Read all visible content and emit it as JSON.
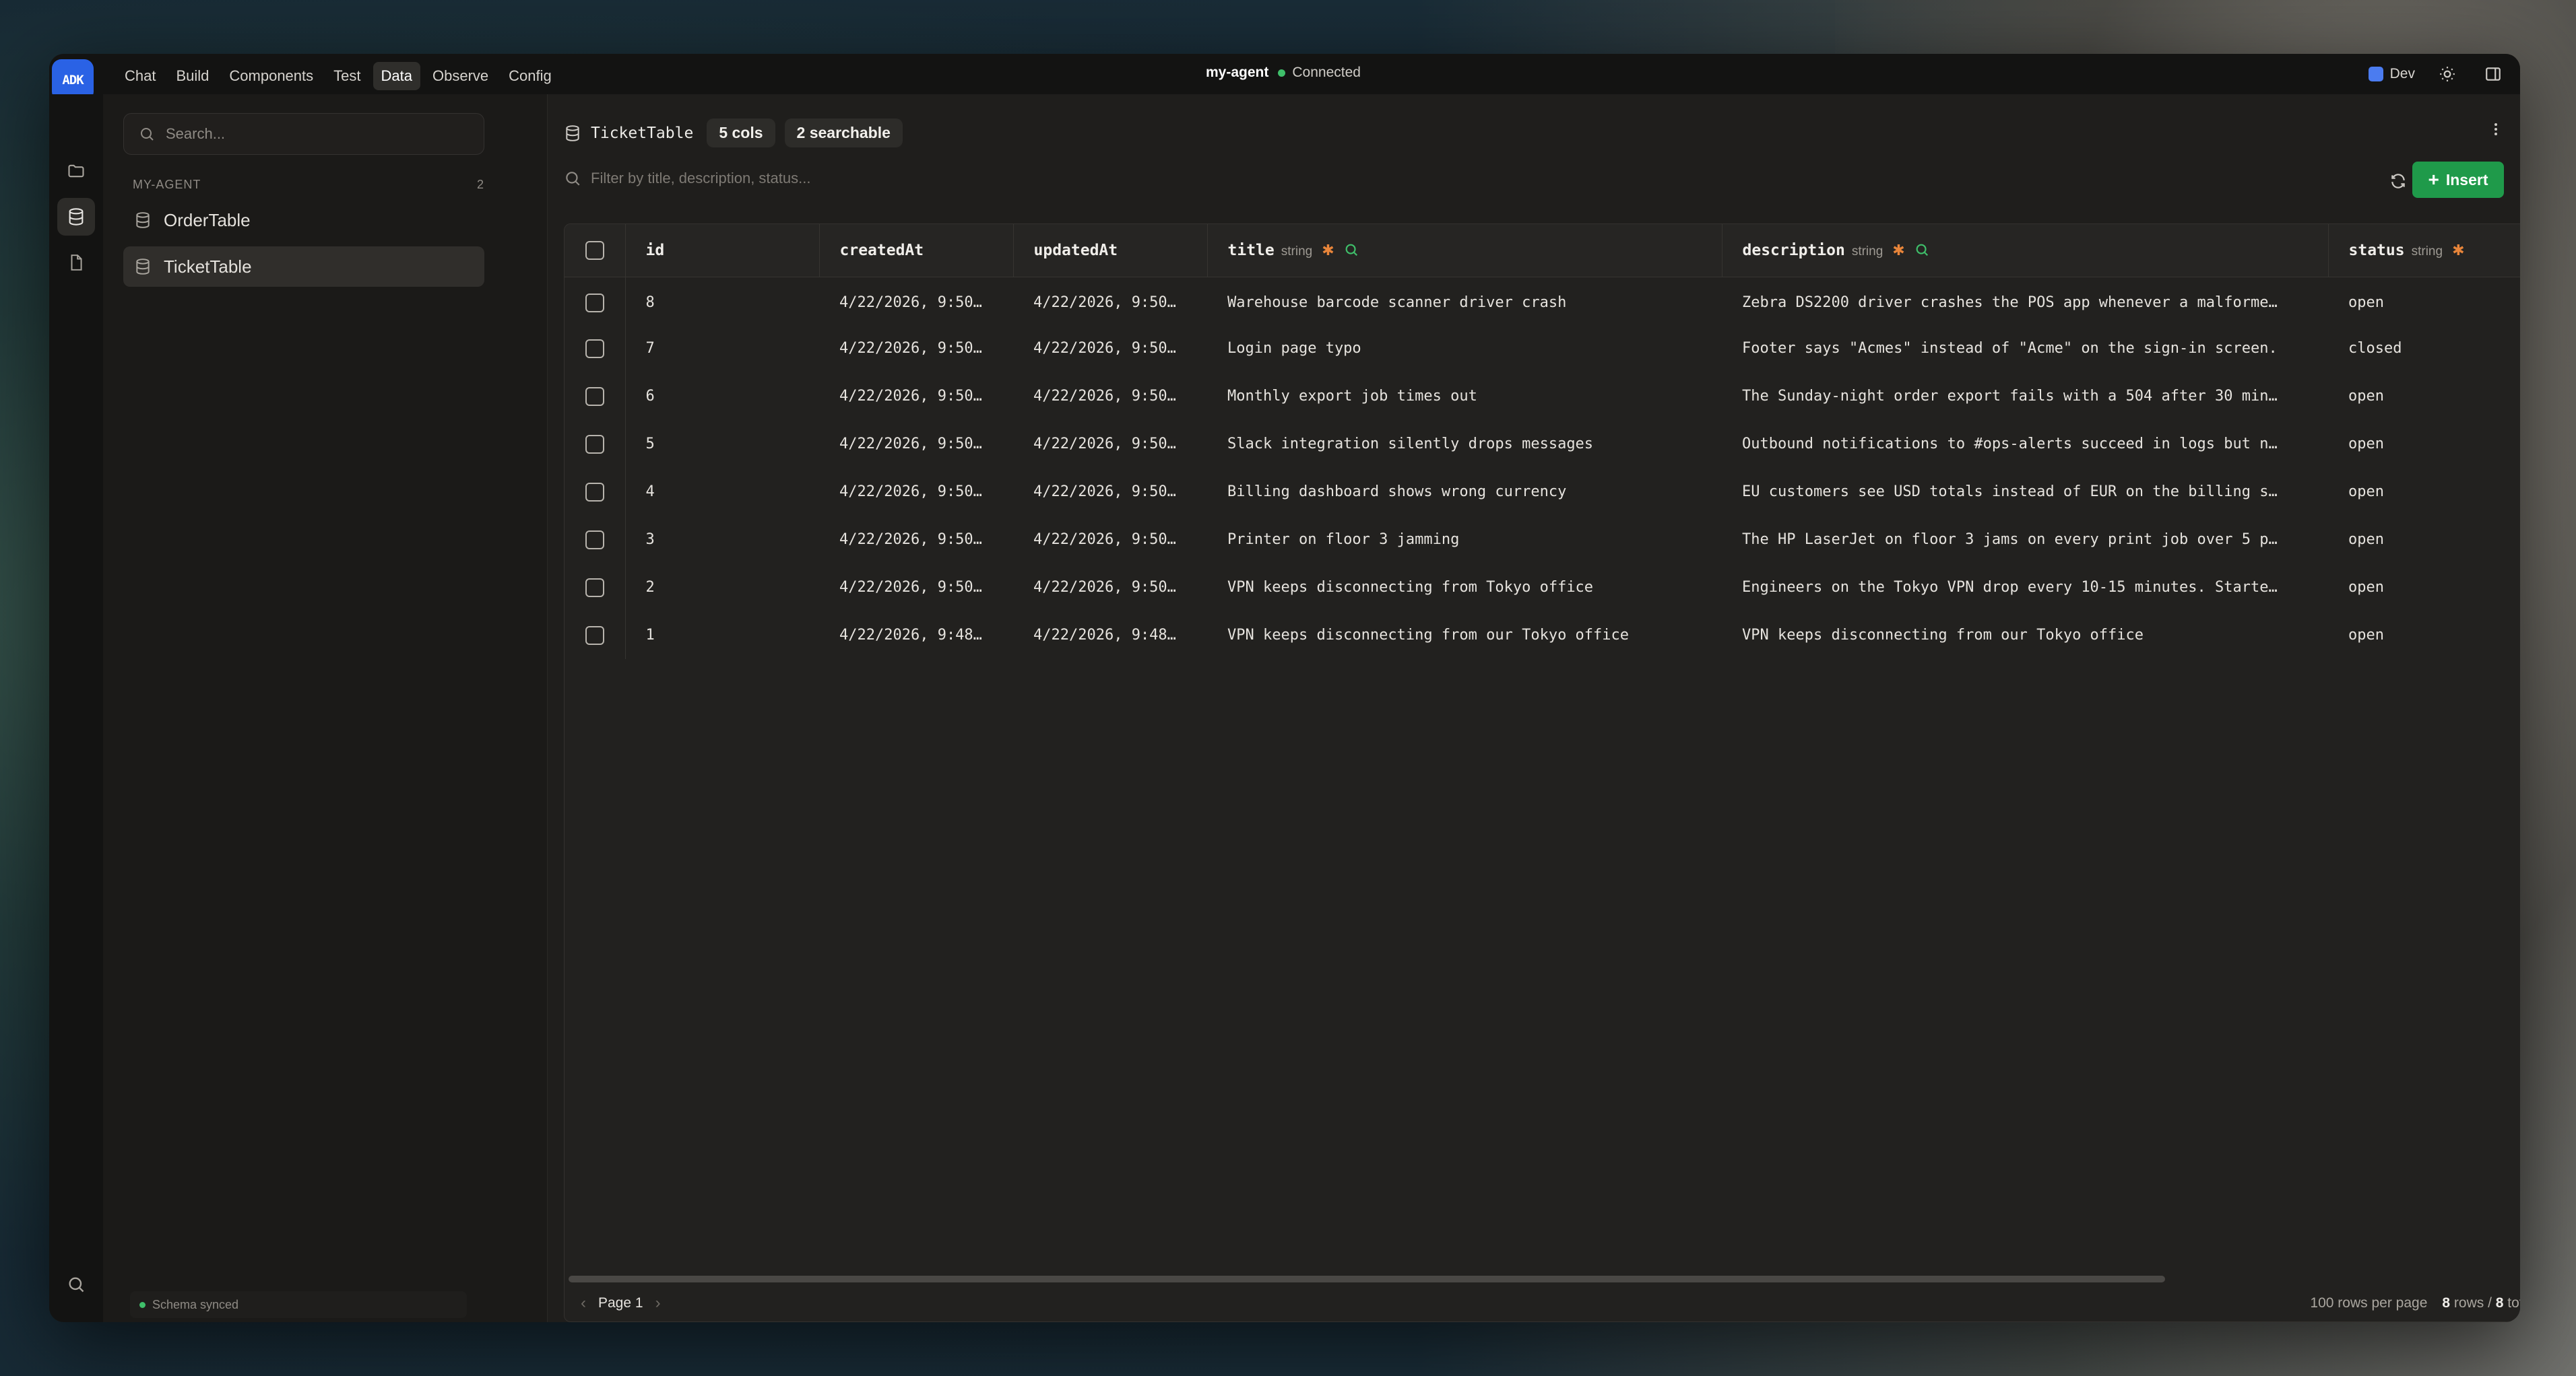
{
  "app": {
    "logo_text": "ADK",
    "menu": [
      "Chat",
      "Build",
      "Components",
      "Test",
      "Data",
      "Observe",
      "Config"
    ],
    "active_menu": "Data",
    "agent_name": "my-agent",
    "connection_status": "Connected",
    "environment": "Dev"
  },
  "rail": {
    "icons": [
      "folder-icon",
      "database-icon",
      "file-icon",
      "search-icon"
    ]
  },
  "sidebar": {
    "search_placeholder": "Search...",
    "section_label": "MY-AGENT",
    "section_count": "2",
    "tables": [
      "OrderTable",
      "TicketTable"
    ],
    "active_table": "TicketTable",
    "schema_status": "Schema synced"
  },
  "main": {
    "table_name": "TicketTable",
    "cols_badge": "5 cols",
    "searchable_badge": "2 searchable",
    "filter_placeholder": "Filter by title, description, status...",
    "insert_label": "Insert",
    "columns": [
      {
        "name": "id",
        "type": "",
        "required": false,
        "searchable": false
      },
      {
        "name": "createdAt",
        "type": "",
        "required": false,
        "searchable": false
      },
      {
        "name": "updatedAt",
        "type": "",
        "required": false,
        "searchable": false
      },
      {
        "name": "title",
        "type": "string",
        "required": true,
        "searchable": true
      },
      {
        "name": "description",
        "type": "string",
        "required": true,
        "searchable": true
      },
      {
        "name": "status",
        "type": "string",
        "required": true,
        "searchable": false
      }
    ],
    "rows": [
      {
        "id": "8",
        "createdAt": "4/22/2026, 9:50…",
        "updatedAt": "4/22/2026, 9:50…",
        "title": "Warehouse barcode scanner driver crash",
        "description": "Zebra DS2200 driver crashes the POS app whenever a malforme…",
        "status": "open"
      },
      {
        "id": "7",
        "createdAt": "4/22/2026, 9:50…",
        "updatedAt": "4/22/2026, 9:50…",
        "title": "Login page typo",
        "description": "Footer says \"Acmes\" instead of \"Acme\" on the sign-in screen.",
        "status": "closed"
      },
      {
        "id": "6",
        "createdAt": "4/22/2026, 9:50…",
        "updatedAt": "4/22/2026, 9:50…",
        "title": "Monthly export job times out",
        "description": "The Sunday-night order export fails with a 504 after 30 min…",
        "status": "open"
      },
      {
        "id": "5",
        "createdAt": "4/22/2026, 9:50…",
        "updatedAt": "4/22/2026, 9:50…",
        "title": "Slack integration silently drops messages",
        "description": "Outbound notifications to #ops-alerts succeed in logs but n…",
        "status": "open"
      },
      {
        "id": "4",
        "createdAt": "4/22/2026, 9:50…",
        "updatedAt": "4/22/2026, 9:50…",
        "title": "Billing dashboard shows wrong currency",
        "description": "EU customers see USD totals instead of EUR on the billing s…",
        "status": "open"
      },
      {
        "id": "3",
        "createdAt": "4/22/2026, 9:50…",
        "updatedAt": "4/22/2026, 9:50…",
        "title": "Printer on floor 3 jamming",
        "description": "The HP LaserJet on floor 3 jams on every print job over 5 p…",
        "status": "open"
      },
      {
        "id": "2",
        "createdAt": "4/22/2026, 9:50…",
        "updatedAt": "4/22/2026, 9:50…",
        "title": "VPN keeps disconnecting from Tokyo office",
        "description": "Engineers on the Tokyo VPN drop every 10-15 minutes. Starte…",
        "status": "open"
      },
      {
        "id": "1",
        "createdAt": "4/22/2026, 9:48…",
        "updatedAt": "4/22/2026, 9:48…",
        "title": "VPN keeps disconnecting from our Tokyo office",
        "description": "VPN keeps disconnecting from our Tokyo office",
        "status": "open"
      }
    ]
  },
  "footer": {
    "page_label": "Page 1",
    "rows_per_page": "100 rows per page",
    "rows_shown": "8",
    "rows_label": "rows /",
    "rows_total": "8",
    "total_label": "total"
  },
  "colors": {
    "accent": "#2a62e5",
    "insert": "#1f9a4a",
    "connected": "#3fbf6a",
    "required": "#e8853a",
    "searchable": "#3fbf6a"
  }
}
